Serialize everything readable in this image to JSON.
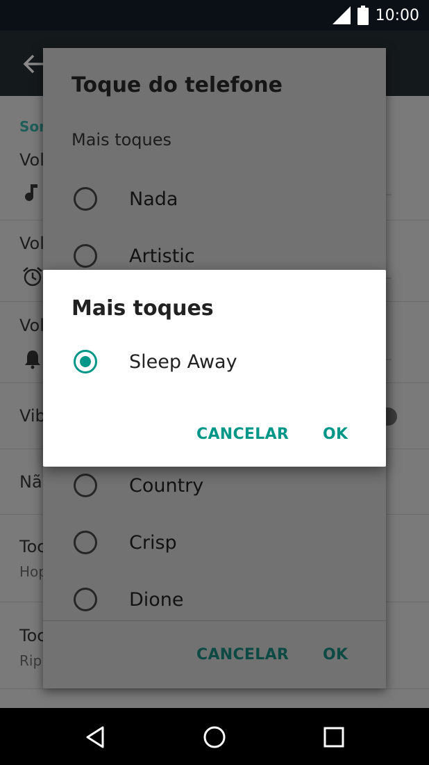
{
  "status": {
    "time": "10:00"
  },
  "settings": {
    "section": "Sor",
    "rows": [
      {
        "title": "Vol"
      },
      {
        "title": "Vol"
      },
      {
        "title": "Vol"
      },
      {
        "title": "Vib"
      },
      {
        "title": "Nã"
      },
      {
        "title": "Toc",
        "sub": "Hop"
      },
      {
        "title": "Toc",
        "sub": "Rip"
      }
    ]
  },
  "dialog_ringtone": {
    "title": "Toque do telefone",
    "subtitle": "Mais toques",
    "options": [
      "Nada",
      "Artistic",
      "Country",
      "Crisp",
      "Dione"
    ],
    "cancel": "CANCELAR",
    "ok": "OK"
  },
  "dialog_more": {
    "title": "Mais toques",
    "selected_option": "Sleep Away",
    "cancel": "CANCELAR",
    "ok": "OK"
  },
  "colors": {
    "accent": "#009688",
    "scrim": "#7a7a7a"
  },
  "icons": [
    "signal-icon",
    "battery-icon",
    "back-arrow-icon",
    "music-note-icon",
    "alarm-clock-icon",
    "bell-icon",
    "nav-back-icon",
    "nav-home-icon",
    "nav-recents-icon"
  ]
}
